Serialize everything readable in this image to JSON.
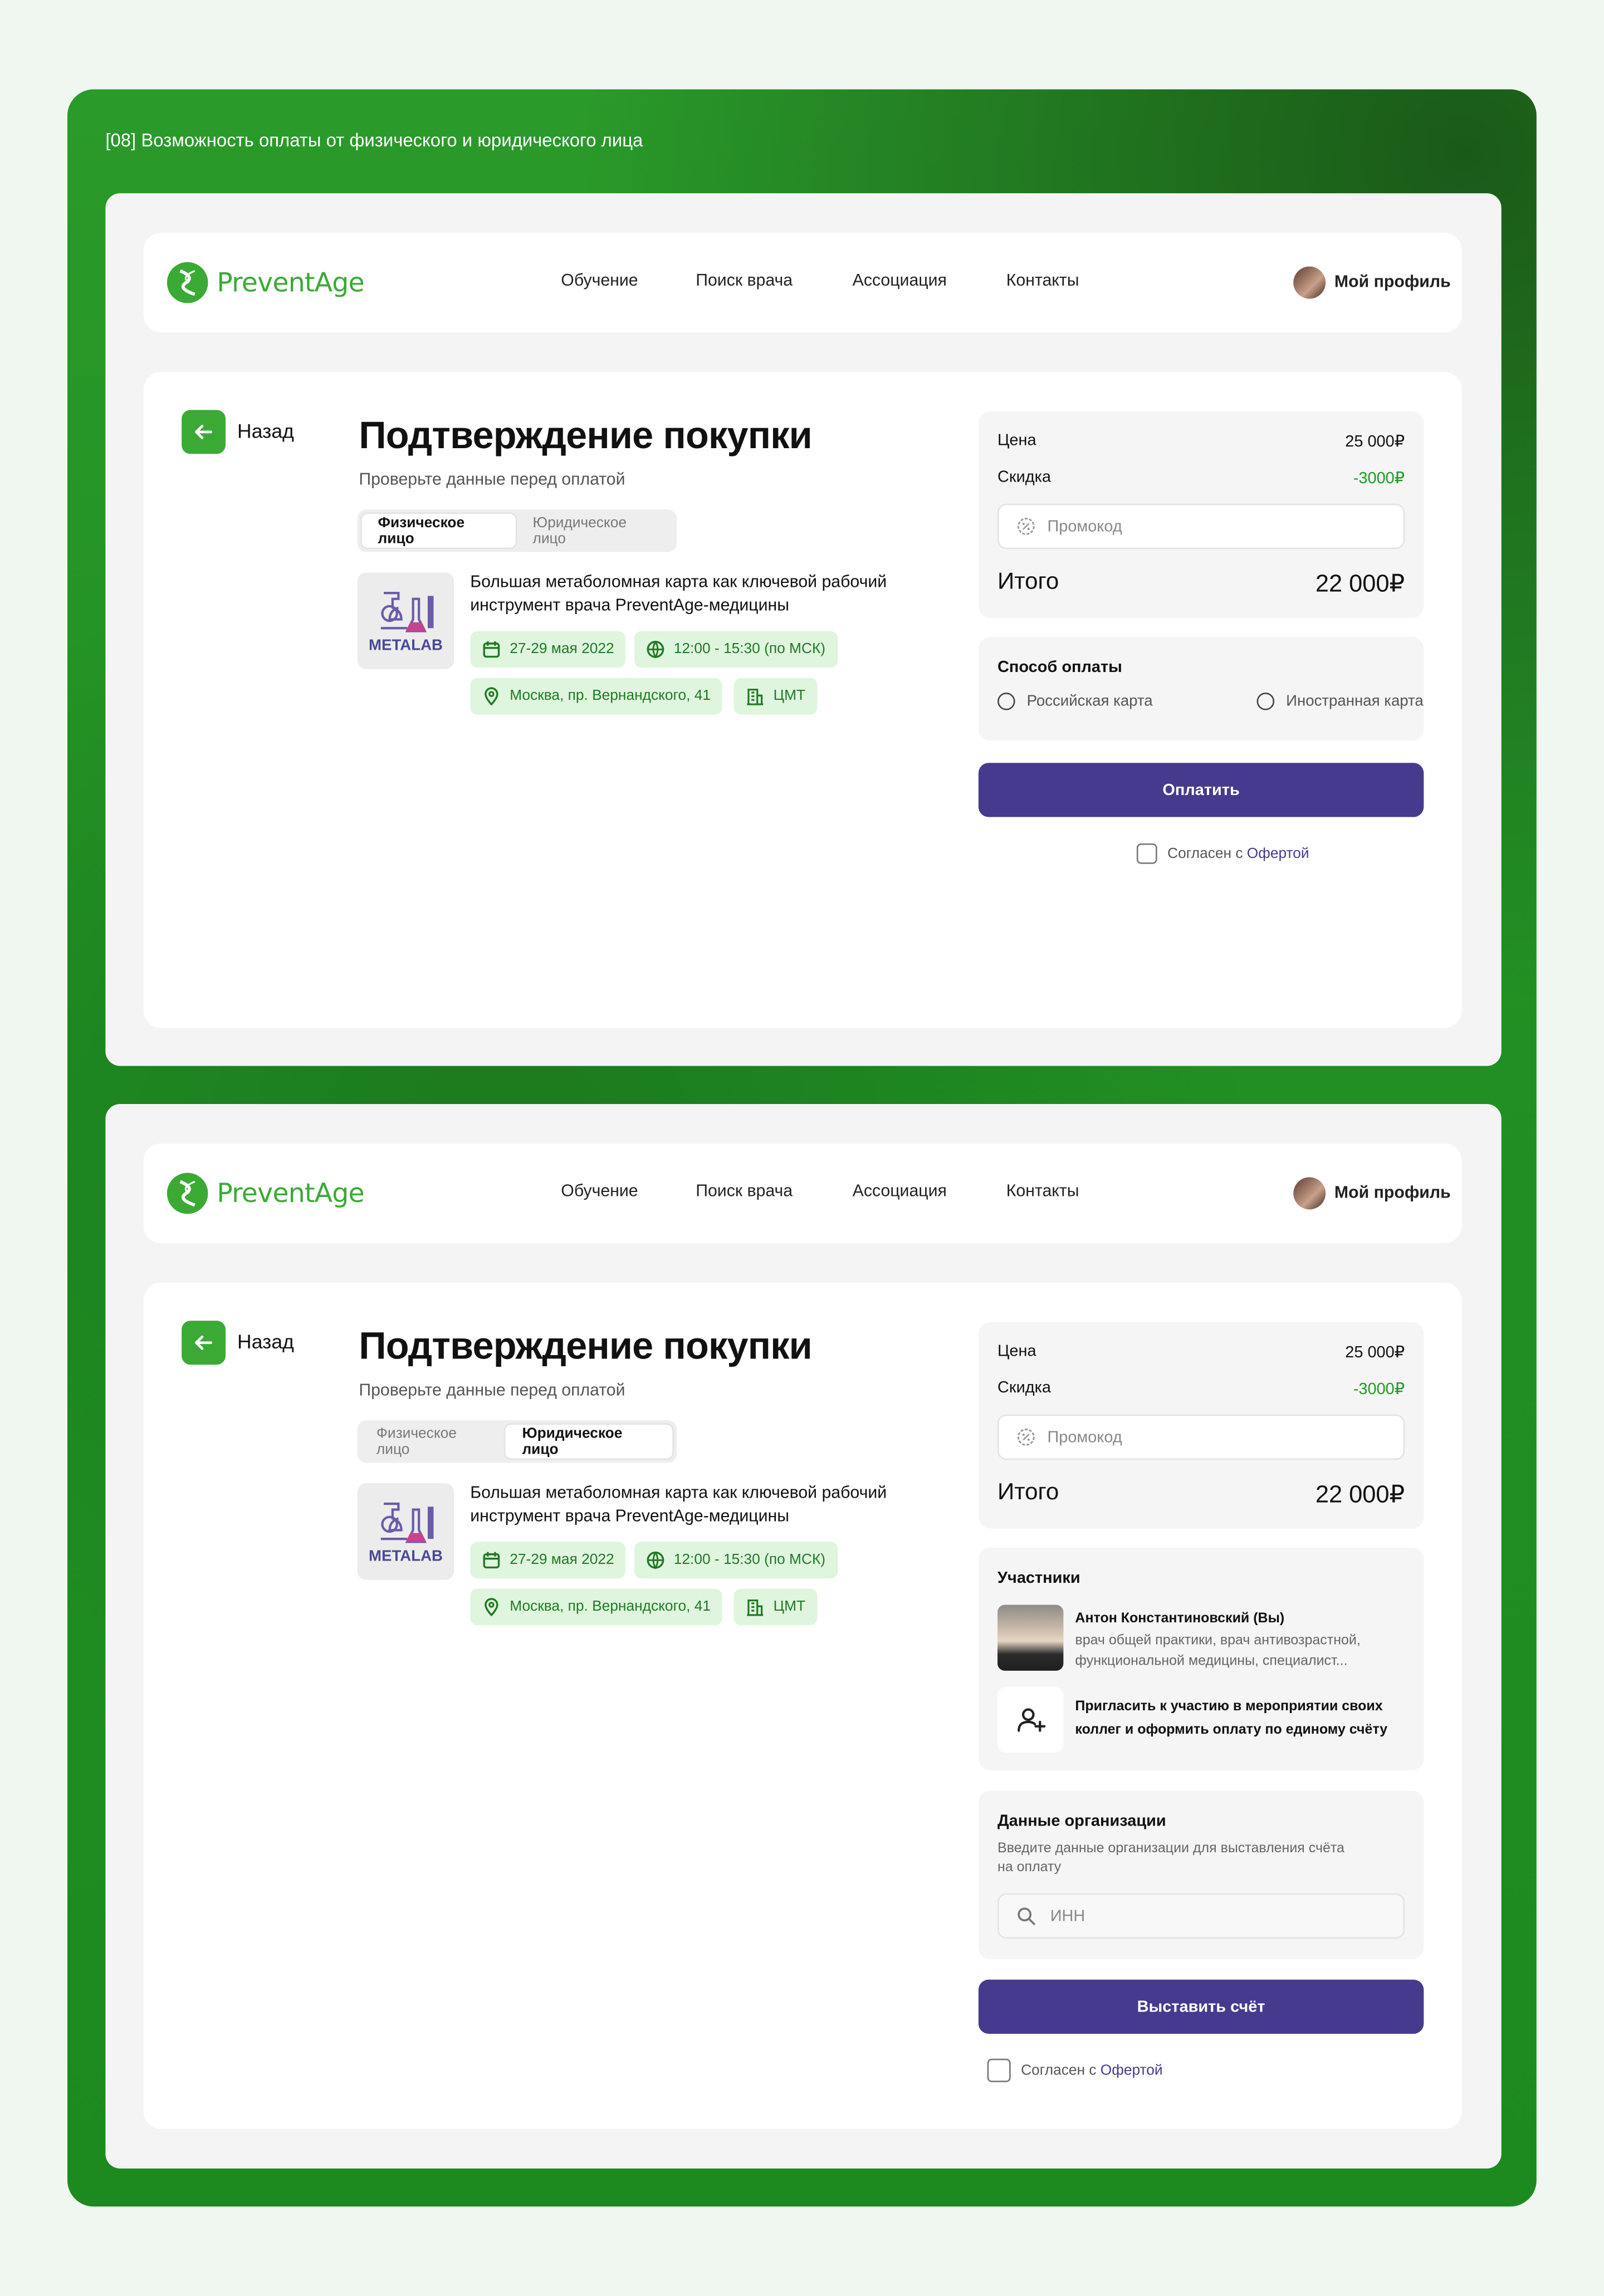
{
  "caption": "[08] Возможность оплаты от физического и юридического лица",
  "brand": {
    "name": "PreventAge",
    "color": "#3aaa35",
    "accent": "#463a8f"
  },
  "nav": {
    "links": [
      "Обучение",
      "Поиск врача",
      "Ассоциация",
      "Контакты"
    ],
    "profile": "Мой профиль"
  },
  "screens": [
    {
      "back": "Назад",
      "title": "Подтверждение покупки",
      "subtitle": "Проверьте данные перед оплатой",
      "tabs": [
        "Физическое лицо",
        "Юридическое лицо"
      ],
      "active_tab": 0,
      "event": {
        "logo_text": "METALAB",
        "title_line1": "Большая метаболомная карта как ключевой рабочий",
        "title_line2": "инструмент врача PreventAge-медицины",
        "date": "27-29 мая 2022",
        "time": "12:00 - 15:30 (по МСК)",
        "address": "Москва, пр. Вернандского, 41",
        "venue": "ЦМТ"
      },
      "summary": {
        "price_label": "Цена",
        "price": "25 000₽",
        "discount_label": "Скидка",
        "discount": "-3000₽",
        "promo_placeholder": "Промокод",
        "total_label": "Итого",
        "total": "22 000₽"
      },
      "payment": {
        "title": "Способ оплаты",
        "options": [
          "Российская карта",
          "Иностранная карта"
        ]
      },
      "button": "Оплатить",
      "agree_prefix": "Согласен с ",
      "agree_link": "Офертой"
    },
    {
      "back": "Назад",
      "title": "Подтверждение покупки",
      "subtitle": "Проверьте данные перед оплатой",
      "tabs": [
        "Физическое лицо",
        "Юридическое лицо"
      ],
      "active_tab": 1,
      "event": {
        "logo_text": "METALAB",
        "title_line1": "Большая метаболомная карта как ключевой рабочий",
        "title_line2": "инструмент врача PreventAge-медицины",
        "date": "27-29 мая 2022",
        "time": "12:00 - 15:30 (по МСК)",
        "address": "Москва, пр. Вернандского, 41",
        "venue": "ЦМТ"
      },
      "summary": {
        "price_label": "Цена",
        "price": "25 000₽",
        "discount_label": "Скидка",
        "discount": "-3000₽",
        "promo_placeholder": "Промокод",
        "total_label": "Итого",
        "total": "22 000₽"
      },
      "participants": {
        "title": "Участники",
        "person_name": "Антон Константиновский (Вы)",
        "person_desc_line1": "врач общей практики, врач антивозрастной,",
        "person_desc_line2": "функциональной медицины, специалист...",
        "invite_line1": "Пригласить к участию в мероприятии своих",
        "invite_line2": "коллег и оформить оплату по единому счёту"
      },
      "organization": {
        "title": "Данные организации",
        "desc_line1": "Введите данные организации для выставления счёта",
        "desc_line2": "на оплату",
        "inn_placeholder": "ИНН"
      },
      "button": "Выставить счёт",
      "agree_prefix": "Согласен с ",
      "agree_link": "Офертой"
    }
  ]
}
